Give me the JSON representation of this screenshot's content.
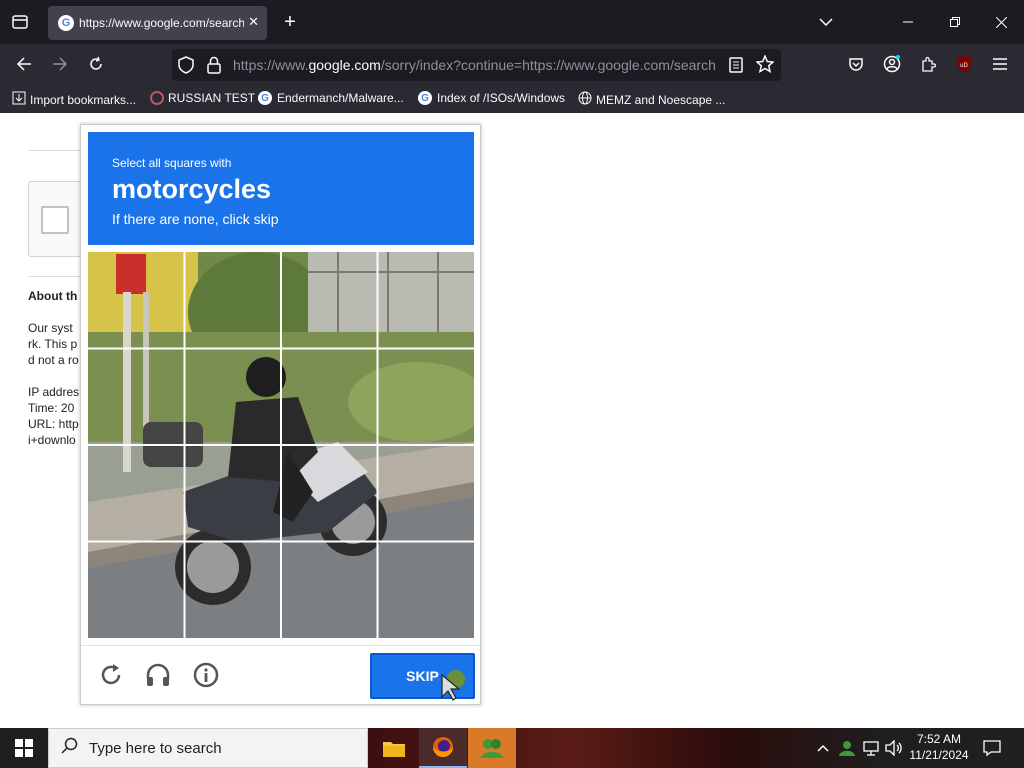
{
  "browser": {
    "tab_title": "https://www.google.com/search",
    "url_prefix": "https://www.",
    "url_domain": "google.com",
    "url_suffix": "/sorry/index?continue=https://www.google.com/search",
    "bookmarks": [
      {
        "label": "Import bookmarks..."
      },
      {
        "label": "RUSSIAN TEST"
      },
      {
        "label": "Endermanch/Malware..."
      },
      {
        "label": "Index of /ISOs/Windows"
      },
      {
        "label": "MEMZ and Noescape ..."
      }
    ]
  },
  "page": {
    "about_heading": "About th",
    "para_lines": [
      "Our syst",
      "rk. This p",
      "d not a ro"
    ],
    "info_lines": [
      "IP addres",
      "Time: 20",
      "URL: http",
      "i+downlo"
    ]
  },
  "captcha": {
    "instruction": "Select all squares with",
    "target": "motorcycles",
    "hint": "If there are none, click skip",
    "skip_label": "SKIP",
    "grid_size": 4
  },
  "taskbar": {
    "search_placeholder": "Type here to search",
    "time": "7:52 AM",
    "date": "11/21/2024"
  },
  "colors": {
    "captcha_blue": "#1a73e8",
    "chrome_dark": "#1c1b22",
    "chrome_mid": "#2b2a33"
  }
}
